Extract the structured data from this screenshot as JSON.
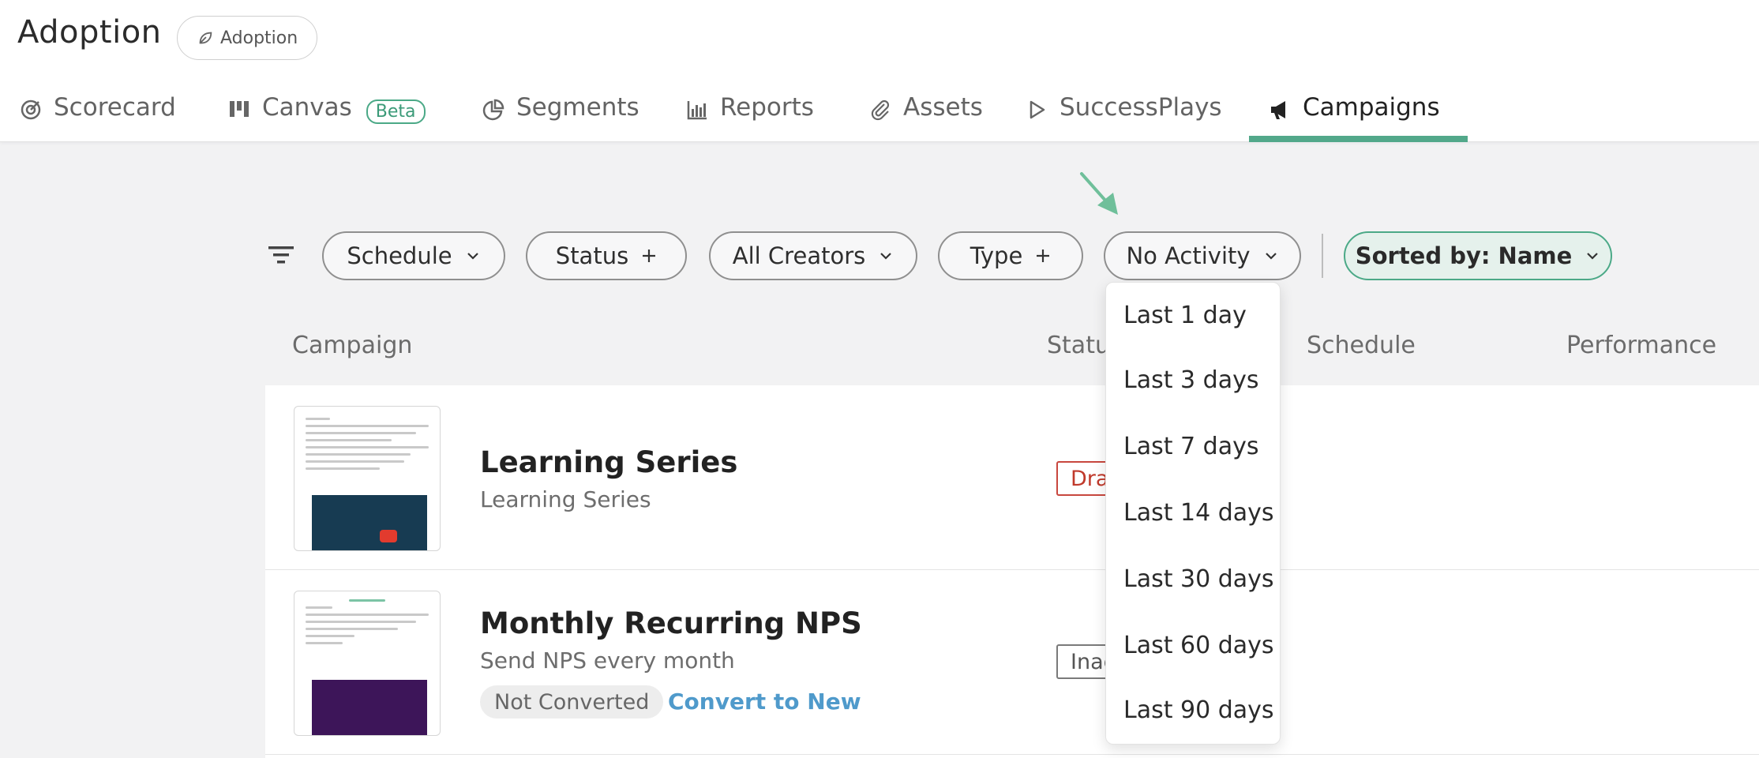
{
  "header": {
    "title": "Adoption",
    "breadcrumb_label": "Adoption"
  },
  "tabs": [
    {
      "label": "Scorecard",
      "icon": "scorecard-icon"
    },
    {
      "label": "Canvas",
      "icon": "canvas-icon",
      "badge": "Beta"
    },
    {
      "label": "Segments",
      "icon": "pie-chart-icon"
    },
    {
      "label": "Reports",
      "icon": "bar-chart-icon"
    },
    {
      "label": "Assets",
      "icon": "paperclip-icon"
    },
    {
      "label": "SuccessPlays",
      "icon": "play-icon"
    },
    {
      "label": "Campaigns",
      "icon": "megaphone-icon",
      "active": true
    }
  ],
  "filters": {
    "schedule": "Schedule",
    "status": "Status",
    "creators": "All Creators",
    "type": "Type",
    "activity": "No Activity",
    "sort": "Sorted by: Name"
  },
  "columns": {
    "campaign": "Campaign",
    "status": "Status",
    "schedule": "Schedule",
    "performance": "Performance"
  },
  "campaigns": [
    {
      "title": "Learning Series",
      "subtitle": "Learning Series",
      "status": "Draft"
    },
    {
      "title": "Monthly Recurring NPS",
      "subtitle": "Send NPS every month",
      "status": "Inactive",
      "conversion": "Not Converted",
      "convert_link": "Convert to New"
    }
  ],
  "activity_dropdown": {
    "options": [
      "Last 1 day",
      "Last 3 days",
      "Last 7 days",
      "Last 14 days",
      "Last 30 days",
      "Last 60 days",
      "Last 90 days"
    ]
  },
  "colors": {
    "accent": "#52a88a",
    "link": "#4f9acb",
    "draft": "#c0392b"
  }
}
